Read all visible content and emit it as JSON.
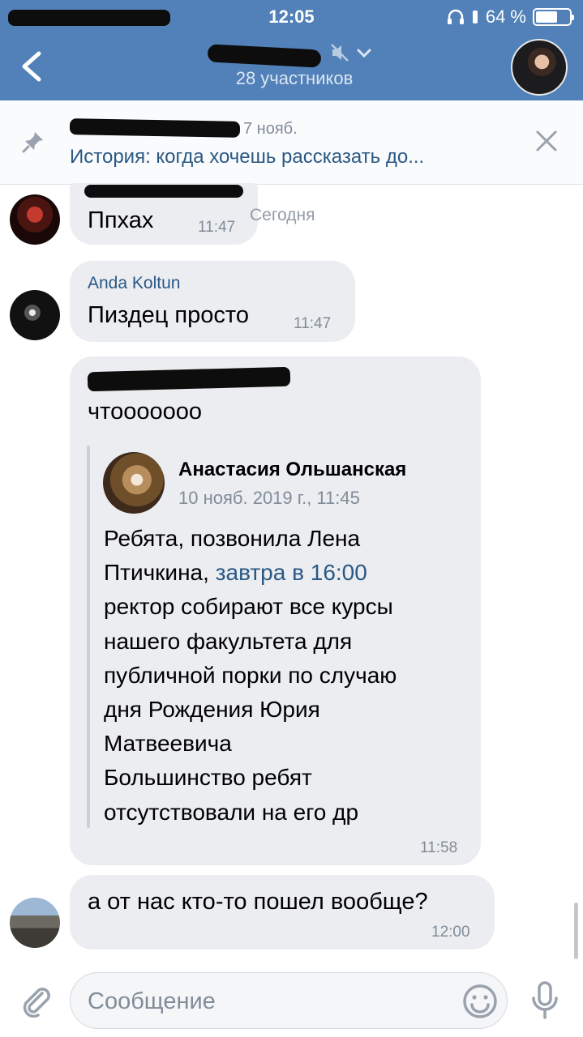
{
  "status_bar": {
    "time": "12:05",
    "battery": "64 %",
    "battery_level": 0.64
  },
  "header": {
    "participants": "28 участников",
    "accent": "#5181b8"
  },
  "pinned": {
    "date": "7 нояб.",
    "preview": "История: когда хочешь рассказать до..."
  },
  "chat": {
    "today_label": "Сегодня",
    "messages": [
      {
        "sender": "",
        "text": "Ппхах",
        "time": "11:47"
      },
      {
        "sender": "Anda Koltun",
        "text": "Пиздец просто",
        "time": "11:47"
      },
      {
        "sender": "",
        "text": "чтоооoooo",
        "time": "11:58",
        "forwarded": {
          "author": "Анастасия Ольшанская",
          "date": "10 нояб. 2019 г., 11:45",
          "lines": [
            "Ребята, позвонила Лена",
            "Птичкина,",
            "завтра в 16:00",
            "ректор собирают все курсы",
            "нашего факультета для",
            "публичной порки по случаю",
            "дня Рождения Юрия",
            "Матвеевича",
            "Большинство ребят",
            "отсутствовали на его др"
          ]
        }
      },
      {
        "sender": "",
        "text": "а от нас кто-то пошел вообще?",
        "time": "12:00"
      }
    ]
  },
  "composer": {
    "placeholder": "Сообщение"
  },
  "colors": {
    "bubble": "#ebedf0",
    "link": "#2a5885",
    "meta": "#818c99"
  }
}
